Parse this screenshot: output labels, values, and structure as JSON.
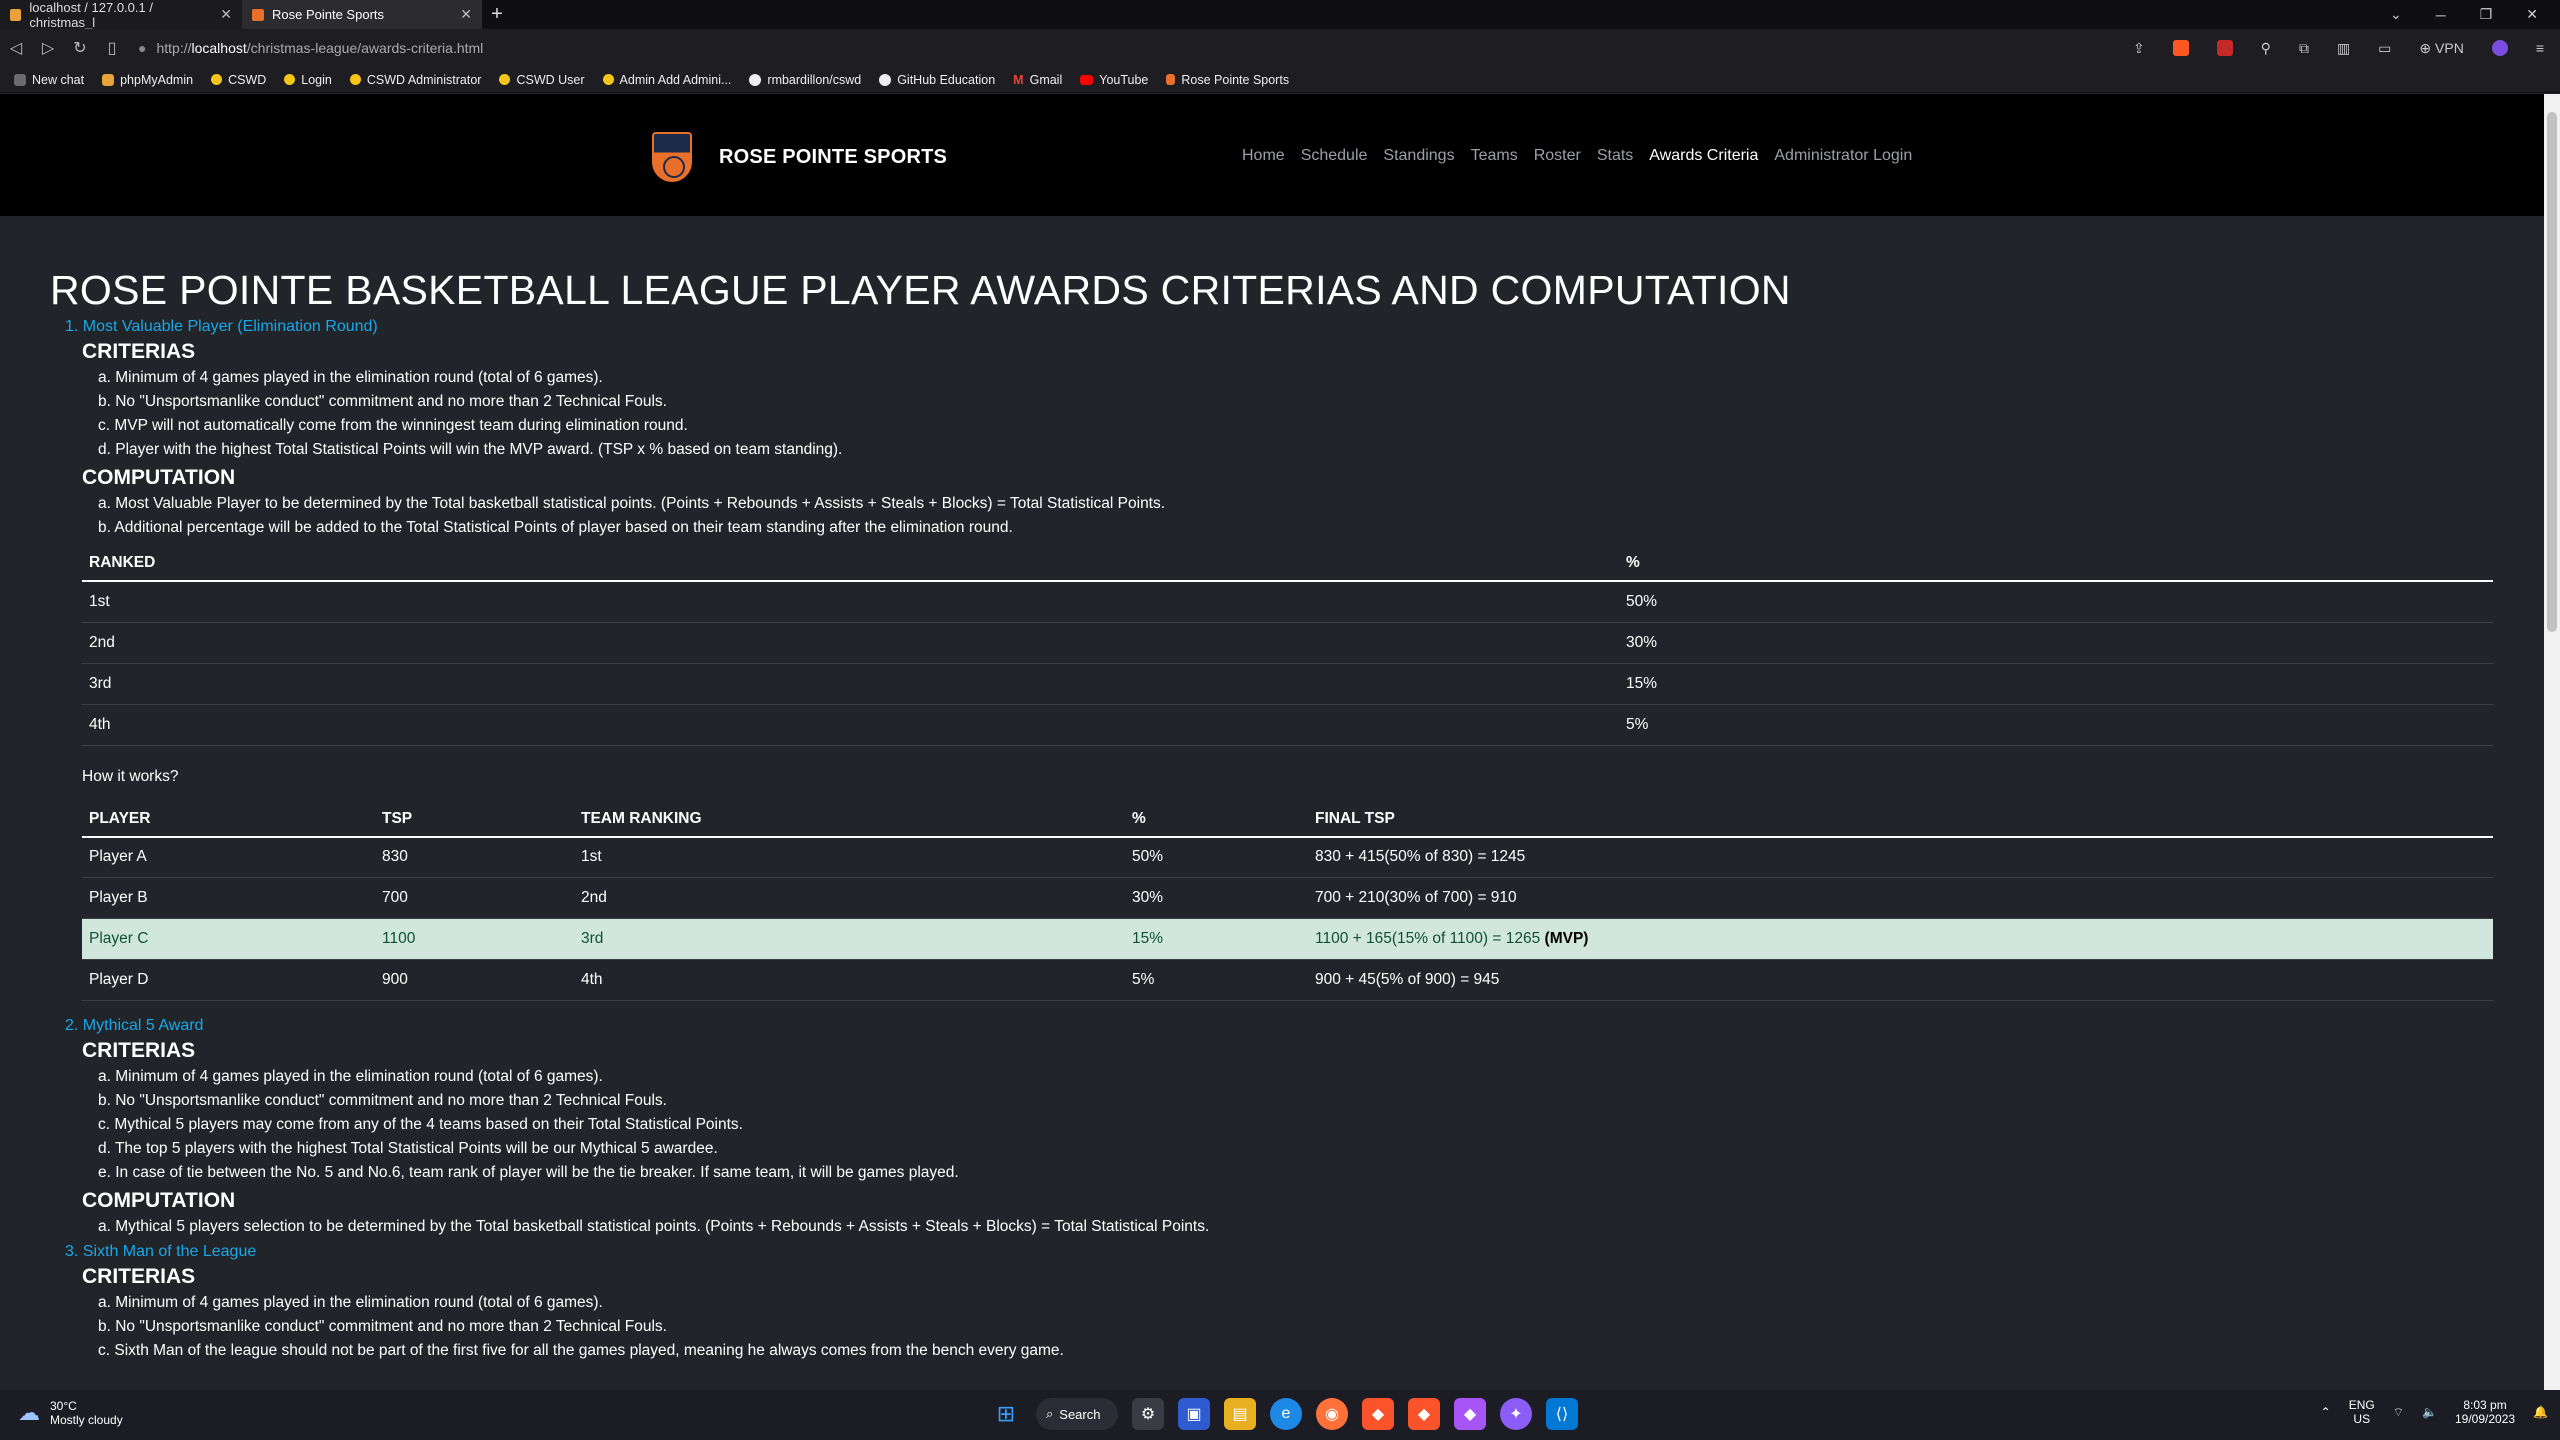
{
  "browser": {
    "tabs": [
      {
        "title": "localhost / 127.0.0.1 / christmas_l"
      },
      {
        "title": "Rose Pointe Sports"
      }
    ],
    "url_prefix": "http://",
    "url_host": "localhost",
    "url_path": "/christmas-league/awards-criteria.html",
    "vpn_label": "VPN",
    "bookmarks": [
      "New chat",
      "phpMyAdmin",
      "CSWD",
      "Login",
      "CSWD Administrator",
      "CSWD User",
      "Admin Add Admini...",
      "rmbardillon/cswd",
      "GitHub Education",
      "Gmail",
      "YouTube",
      "Rose Pointe Sports"
    ]
  },
  "site": {
    "brand": "ROSE POINTE SPORTS",
    "nav": [
      "Home",
      "Schedule",
      "Standings",
      "Teams",
      "Roster",
      "Stats",
      "Awards Criteria",
      "Administrator Login"
    ],
    "active_nav": "Awards Criteria"
  },
  "page": {
    "title": "ROSE POINTE BASKETBALL LEAGUE PLAYER AWARDS CRITERIAS AND COMPUTATION",
    "criterias_heading": "CRITERIAS",
    "computation_heading": "COMPUTATION",
    "award1": {
      "name": "1. Most Valuable Player (Elimination Round)",
      "criterias": [
        "a. Minimum of 4 games played in the elimination round (total of 6 games).",
        "b. No \"Unsportsmanlike conduct\" commitment and no more than 2 Technical Fouls.",
        "c. MVP will not automatically come from the winningest team during elimination round.",
        "d. Player with the highest Total Statistical Points will win the MVP award. (TSP x % based on team standing)."
      ],
      "computation": [
        "a. Most Valuable Player to be determined by the Total basketball statistical points. (Points + Rebounds + Assists + Steals + Blocks) = Total Statistical Points.",
        "b. Additional percentage will be added to the Total Statistical Points of player based on their team standing after the elimination round."
      ],
      "rank_table": {
        "headers": [
          "RANKED",
          "%"
        ],
        "rows": [
          [
            "1st",
            "50%"
          ],
          [
            "2nd",
            "30%"
          ],
          [
            "3rd",
            "15%"
          ],
          [
            "4th",
            "5%"
          ]
        ]
      },
      "how_it_works": "How it works?",
      "example_table": {
        "headers": [
          "PLAYER",
          "TSP",
          "TEAM RANKING",
          "%",
          "FINAL TSP"
        ],
        "rows": [
          [
            "Player A",
            "830",
            "1st",
            "50%",
            "830 + 415(50% of 830) = 1245",
            ""
          ],
          [
            "Player B",
            "700",
            "2nd",
            "30%",
            "700 + 210(30% of 700) = 910",
            ""
          ],
          [
            "Player C",
            "1100",
            "3rd",
            "15%",
            "1100 + 165(15% of 1100) = 1265 ",
            "(MVP)"
          ],
          [
            "Player D",
            "900",
            "4th",
            "5%",
            "900 + 45(5% of 900) = 945",
            ""
          ]
        ]
      }
    },
    "award2": {
      "name": "2. Mythical 5 Award",
      "criterias": [
        "a. Minimum of 4 games played in the elimination round (total of 6 games).",
        "b. No \"Unsportsmanlike conduct\" commitment and no more than 2 Technical Fouls.",
        "c. Mythical 5 players may come from any of the 4 teams based on their Total Statistical Points.",
        "d. The top 5 players with the highest Total Statistical Points will be our Mythical 5 awardee.",
        "e. In case of tie between the No. 5 and No.6, team rank of player will be the tie breaker. If same team, it will be games played."
      ],
      "computation": [
        "a. Mythical 5 players selection to be determined by the Total basketball statistical points. (Points + Rebounds + Assists + Steals + Blocks) = Total Statistical Points."
      ]
    },
    "award3": {
      "name": "3. Sixth Man of the League",
      "criterias": [
        "a. Minimum of 4 games played in the elimination round (total of 6 games).",
        "b. No \"Unsportsmanlike conduct\" commitment and no more than 2 Technical Fouls.",
        "c. Sixth Man of the league should not be part of the first five for all the games played, meaning he always comes from the bench every game."
      ]
    }
  },
  "taskbar": {
    "temp": "30°C",
    "weather": "Mostly cloudy",
    "search": "Search",
    "lang1": "ENG",
    "lang2": "US",
    "time": "8:03 pm",
    "date": "19/09/2023"
  }
}
